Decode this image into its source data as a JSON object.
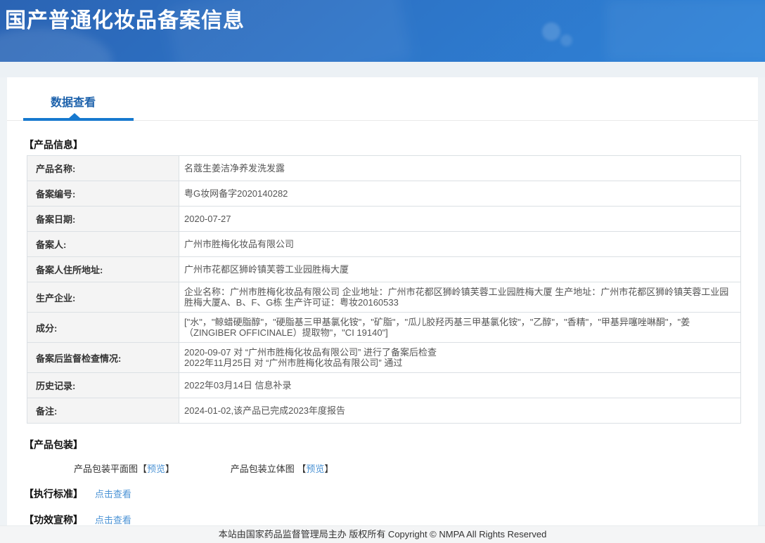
{
  "header": {
    "title": "国产普通化妆品备案信息"
  },
  "tabs": {
    "data_view": "数据查看"
  },
  "product_info": {
    "section_title": "【产品信息】",
    "rows": [
      {
        "label": "产品名称:",
        "value": "名蔻生姜洁净养发洗发露"
      },
      {
        "label": "备案编号:",
        "value": "粤G妆网备字2020140282"
      },
      {
        "label": "备案日期:",
        "value": "2020-07-27"
      },
      {
        "label": "备案人:",
        "value": "广州市胜梅化妆品有限公司"
      },
      {
        "label": "备案人住所地址:",
        "value": "广州市花都区狮岭镇芙蓉工业园胜梅大厦"
      },
      {
        "label": "生产企业:",
        "value": "企业名称：广州市胜梅化妆品有限公司 企业地址：广州市花都区狮岭镇芙蓉工业园胜梅大厦 生产地址：广州市花都区狮岭镇芙蓉工业园胜梅大厦A、B、F、G栋 生产许可证：粤妆20160533"
      },
      {
        "label": "成分:",
        "value": "[\"水\"，\"鲸蜡硬脂醇\"，\"硬脂基三甲基氯化铵\"，\"矿脂\"，\"瓜儿胶羟丙基三甲基氯化铵\"，\"乙醇\"，\"香精\"，\"甲基异噻唑啉酮\"，\"姜（ZINGIBER OFFICINALE）提取物\"，\"CI 19140\"]"
      },
      {
        "label": "备案后监督检查情况:",
        "value": "2020-09-07 对 “广州市胜梅化妆品有限公司” 进行了备案后检查\n2022年11月25日 对 “广州市胜梅化妆品有限公司” 通过"
      },
      {
        "label": "历史记录:",
        "value": "2022年03月14日 信息补录"
      },
      {
        "label": "备注:",
        "value": "2024-01-02,该产品已完成2023年度报告"
      }
    ]
  },
  "packaging": {
    "section_title": "【产品包装】",
    "bracket_open": "【",
    "bracket_close": "】",
    "items": [
      {
        "label": "产品包装平面图",
        "link": "预览"
      },
      {
        "label": "产品包装立体图 ",
        "link": "预览"
      }
    ]
  },
  "standards": {
    "section_title": "【执行标准】",
    "link": "点击查看"
  },
  "efficacy": {
    "section_title": "【功效宣称】",
    "link": "点击查看"
  },
  "footer": {
    "text": "本站由国家药品监督管理局主办 版权所有 Copyright © NMPA All Rights Reserved"
  },
  "colors": {
    "banner_gradient_start": "#2b64b4",
    "banner_gradient_end": "#2e83d8",
    "tab_text": "#1c61ab",
    "tab_underline": "#1779cf",
    "link_blue": "#4b93d5",
    "label_cell_bg": "#f4f4f4",
    "table_border": "#dbe0e4",
    "footer_bg": "#f4f5f6"
  }
}
